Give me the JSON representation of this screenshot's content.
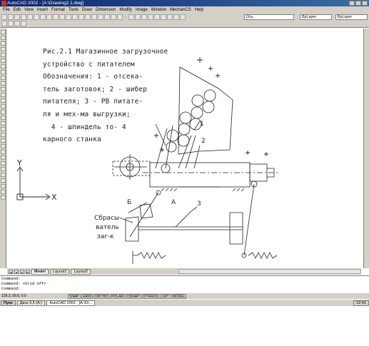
{
  "window": {
    "title": "AutoCAD 2002 - [A:\\Drawing2.1.dwg]"
  },
  "menu": [
    "File",
    "Edit",
    "View",
    "Insert",
    "Format",
    "Tools",
    "Draw",
    "Dimension",
    "Modify",
    "Image",
    "Window",
    "MechanCS",
    "Help"
  ],
  "toolbar": {
    "layer_value": "Ось",
    "color_value": "ByLayer",
    "linetype_value": "ByLayer"
  },
  "drawing": {
    "caption_lines": [
      "Рис.2.1 Магазинное загрузочное",
      "устройство с питателем",
      "Обозначения: 1 - отсека-",
      "тель заготовок; 2 - шибер",
      "питателя; 3 - РВ питате-",
      "ля и мех-ма выгрузки;",
      "  4 - шпиндель то- 4",
      "карного станка"
    ],
    "labels": {
      "num1": "1",
      "num2": "2",
      "num3": "3",
      "letter_b": "Б",
      "letter_a": "А",
      "drop_line1": "Сбрасы-",
      "drop_line2": "ватель",
      "drop_line3": "заг-к",
      "axis_x": "X",
      "axis_y": "Y"
    }
  },
  "tabs": {
    "items": [
      "Model",
      "Layout1",
      "Layout2"
    ],
    "active": "Model"
  },
  "command": {
    "lines": [
      "Command:",
      "Command:  <Grid off>",
      "Command:"
    ]
  },
  "status": {
    "coords": "128.3, 58.6, 0.0",
    "modes": [
      "SNAP",
      "GRID",
      "ORTHO",
      "POLAR",
      "OSNAP",
      "OTRACK",
      "LWT",
      "MODEL"
    ]
  },
  "taskbar": {
    "start": "Пуск",
    "items": [
      "Диск 3,5 (A:)",
      "AutoCAD 2002 - [A:\\Dr..."
    ],
    "active_item": 1,
    "clock": "12:41"
  }
}
